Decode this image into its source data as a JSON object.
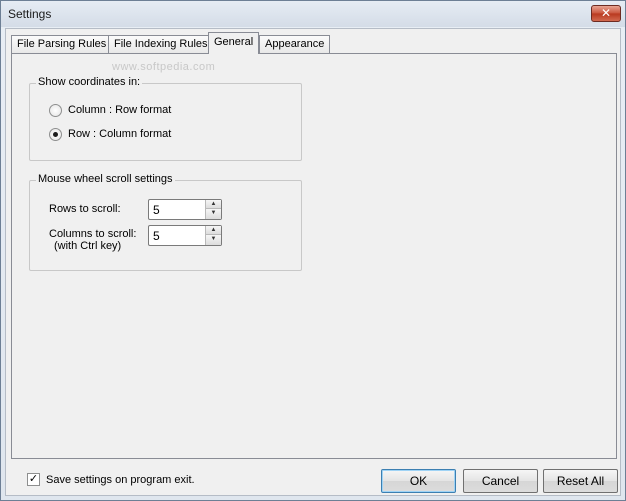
{
  "window": {
    "title": "Settings",
    "close_label": "✕"
  },
  "tabs": [
    {
      "label": "File Parsing Rules"
    },
    {
      "label": "File Indexing Rules"
    },
    {
      "label": "General"
    },
    {
      "label": "Appearance"
    }
  ],
  "watermark": "www.softpedia.com",
  "coordinates_group": {
    "title": "Show coordinates in:",
    "options": [
      {
        "label": "Column : Row  format",
        "checked": false
      },
      {
        "label": "Row : Column  format",
        "checked": true
      }
    ]
  },
  "scroll_group": {
    "title": "Mouse wheel scroll settings",
    "rows_label": "Rows to scroll:",
    "rows_value": "5",
    "columns_label": "Columns to scroll:",
    "columns_sublabel": "(with Ctrl key)",
    "columns_value": "5"
  },
  "footer": {
    "save_on_exit_label": "Save settings on program exit.",
    "save_on_exit_checked": true,
    "check_mark": "✓",
    "ok_label": "OK",
    "cancel_label": "Cancel",
    "reset_label": "Reset All"
  }
}
